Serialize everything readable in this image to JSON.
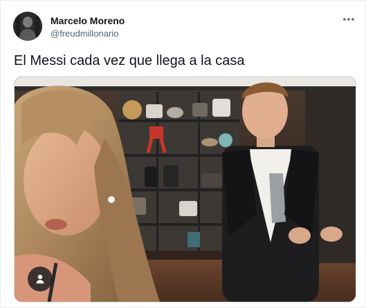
{
  "tweet": {
    "author": {
      "name": "Marcelo Moreno",
      "handle": "@freudmillonario",
      "avatar_icon": "avatar-photo"
    },
    "more_icon": "more-horizontal-icon",
    "text": "El Messi cada vez que llega a la casa",
    "media": {
      "kind": "photo",
      "tag_icon": "person-icon"
    }
  },
  "colors": {
    "text_primary": "#0f1419",
    "text_secondary": "#536471",
    "border": "#e6ecf0"
  }
}
